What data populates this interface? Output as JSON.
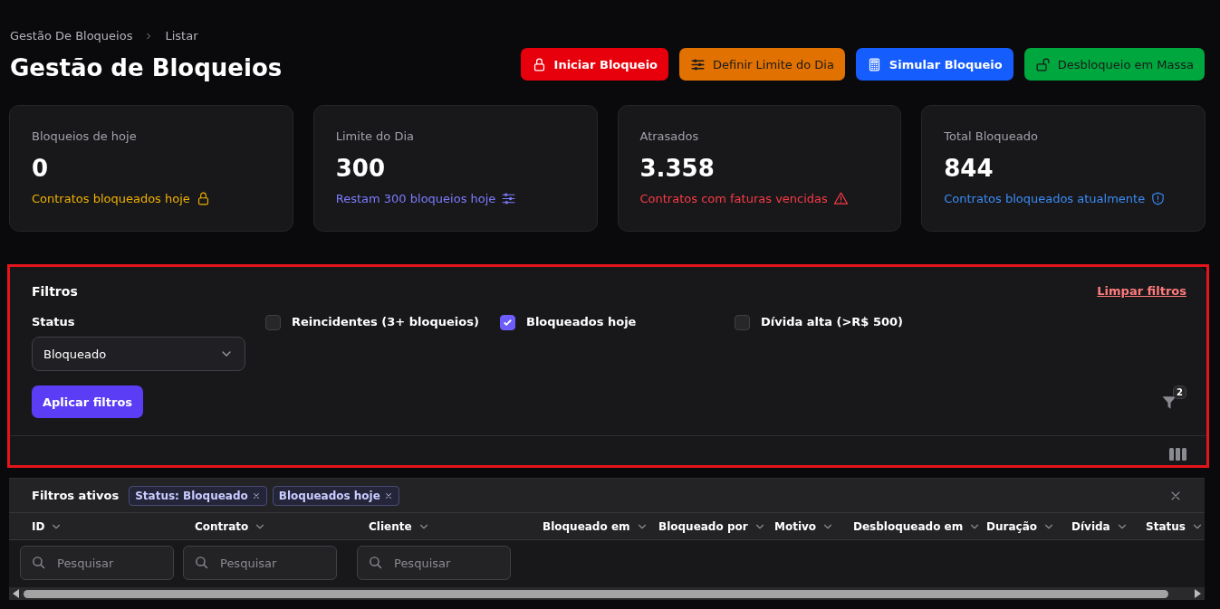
{
  "breadcrumb": [
    "Gestão De Bloqueios",
    "Listar"
  ],
  "title": "Gestão de Bloqueios",
  "actions": [
    {
      "label": "Iniciar Bloqueio",
      "kind": "lock",
      "color": "#e7000b"
    },
    {
      "label": "Definir Limite do Dia",
      "kind": "sliders",
      "color": "#e17100"
    },
    {
      "label": "Simular Bloqueio",
      "kind": "calculator",
      "color": "#155dfc"
    },
    {
      "label": "Desbloqueio em Massa",
      "kind": "unlock",
      "color": "#00a63e"
    }
  ],
  "stats": [
    {
      "label": "Bloqueios de hoje",
      "value": "0",
      "note": "Contratos bloqueados hoje",
      "kind": "lock",
      "color": "#f0b100"
    },
    {
      "label": "Limite do Dia",
      "value": "300",
      "note": "Restam 300 bloqueios hoje",
      "kind": "sliders",
      "color": "#7c7cff"
    },
    {
      "label": "Atrasados",
      "value": "3.358",
      "note": "Contratos com faturas vencidas",
      "kind": "warning",
      "color": "#fb3a45"
    },
    {
      "label": "Total Bloqueado",
      "value": "844",
      "note": "Contratos bloqueados atualmente",
      "kind": "shield",
      "color": "#3b8cf6"
    }
  ],
  "filters": {
    "title": "Filtros",
    "clear_link": "Limpar filtros",
    "status_label": "Status",
    "status_value": "Bloqueado",
    "checkboxes": [
      {
        "label": "Reincidentes (3+ bloqueios)",
        "checked": false
      },
      {
        "label": "Bloqueados hoje",
        "checked": true
      },
      {
        "label": "Dívida alta (>R$ 500)",
        "checked": false
      }
    ],
    "apply_button": "Aplicar filtros",
    "filter_count": "2"
  },
  "active_filters": {
    "label": "Filtros ativos",
    "chips": [
      "Status: Bloqueado",
      "Bloqueados hoje"
    ]
  },
  "table": {
    "columns": [
      {
        "label": "ID",
        "search_placeholder": "Pesquisar"
      },
      {
        "label": "Contrato",
        "search_placeholder": "Pesquisar"
      },
      {
        "label": "Cliente",
        "search_placeholder": "Pesquisar"
      },
      {
        "label": "Bloqueado em"
      },
      {
        "label": "Bloqueado por"
      },
      {
        "label": "Motivo"
      },
      {
        "label": "Desbloqueado em"
      },
      {
        "label": "Duração"
      },
      {
        "label": "Dívida"
      },
      {
        "label": "Status"
      }
    ]
  }
}
